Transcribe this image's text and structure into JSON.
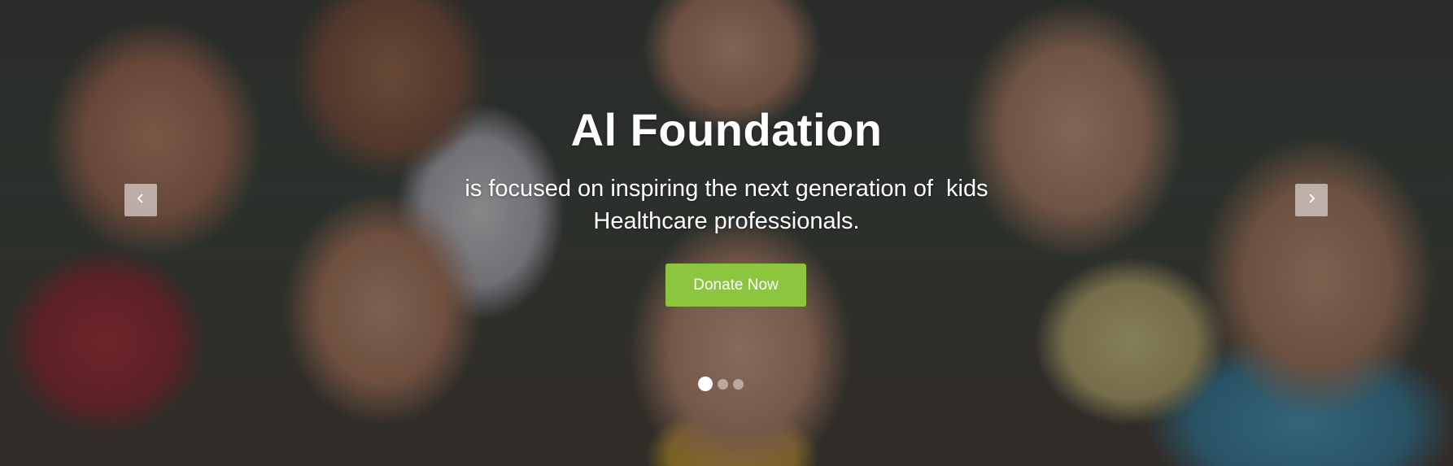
{
  "hero": {
    "title": "Al Foundation",
    "subtitle": "is focused on inspiring the next generation of  kids\nHealthcare professionals.",
    "donate_label": "Donate Now",
    "accent_color": "#8cc63e",
    "prev_icon": "chevron-left-icon",
    "next_icon": "chevron-right-icon",
    "slide_count": 3,
    "active_slide": 1
  }
}
